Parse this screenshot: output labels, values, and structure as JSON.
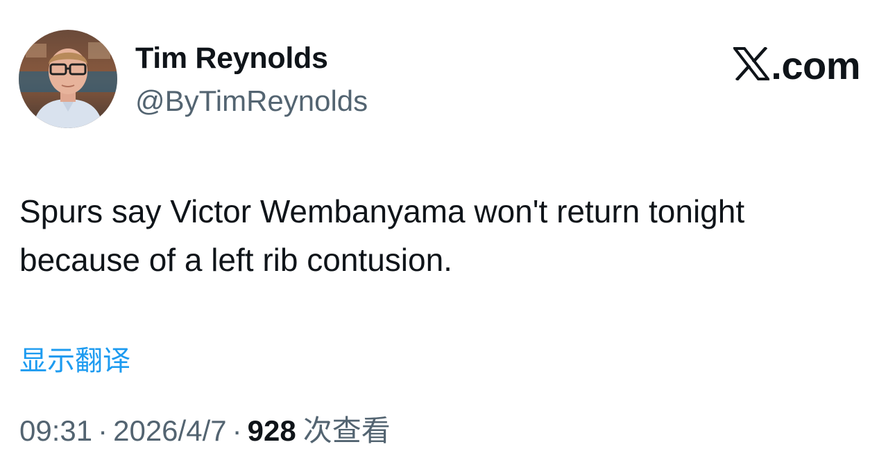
{
  "author": {
    "display_name": "Tim Reynolds",
    "handle": "@ByTimReynolds",
    "avatar_icon": "profile-photo"
  },
  "brand": {
    "label": ".com",
    "logo_icon": "x-logo-icon"
  },
  "tweet": {
    "text": "Spurs say Victor Wembanyama won't return tonight because of a left rib contusion.",
    "translate_label": "显示翻译"
  },
  "meta": {
    "time": "09:31",
    "date": "2026/4/7",
    "separator": "·",
    "views_count": "928",
    "views_label": "次查看"
  },
  "colors": {
    "text_primary": "#0f1419",
    "text_secondary": "#536471",
    "link": "#1d9bf0"
  }
}
